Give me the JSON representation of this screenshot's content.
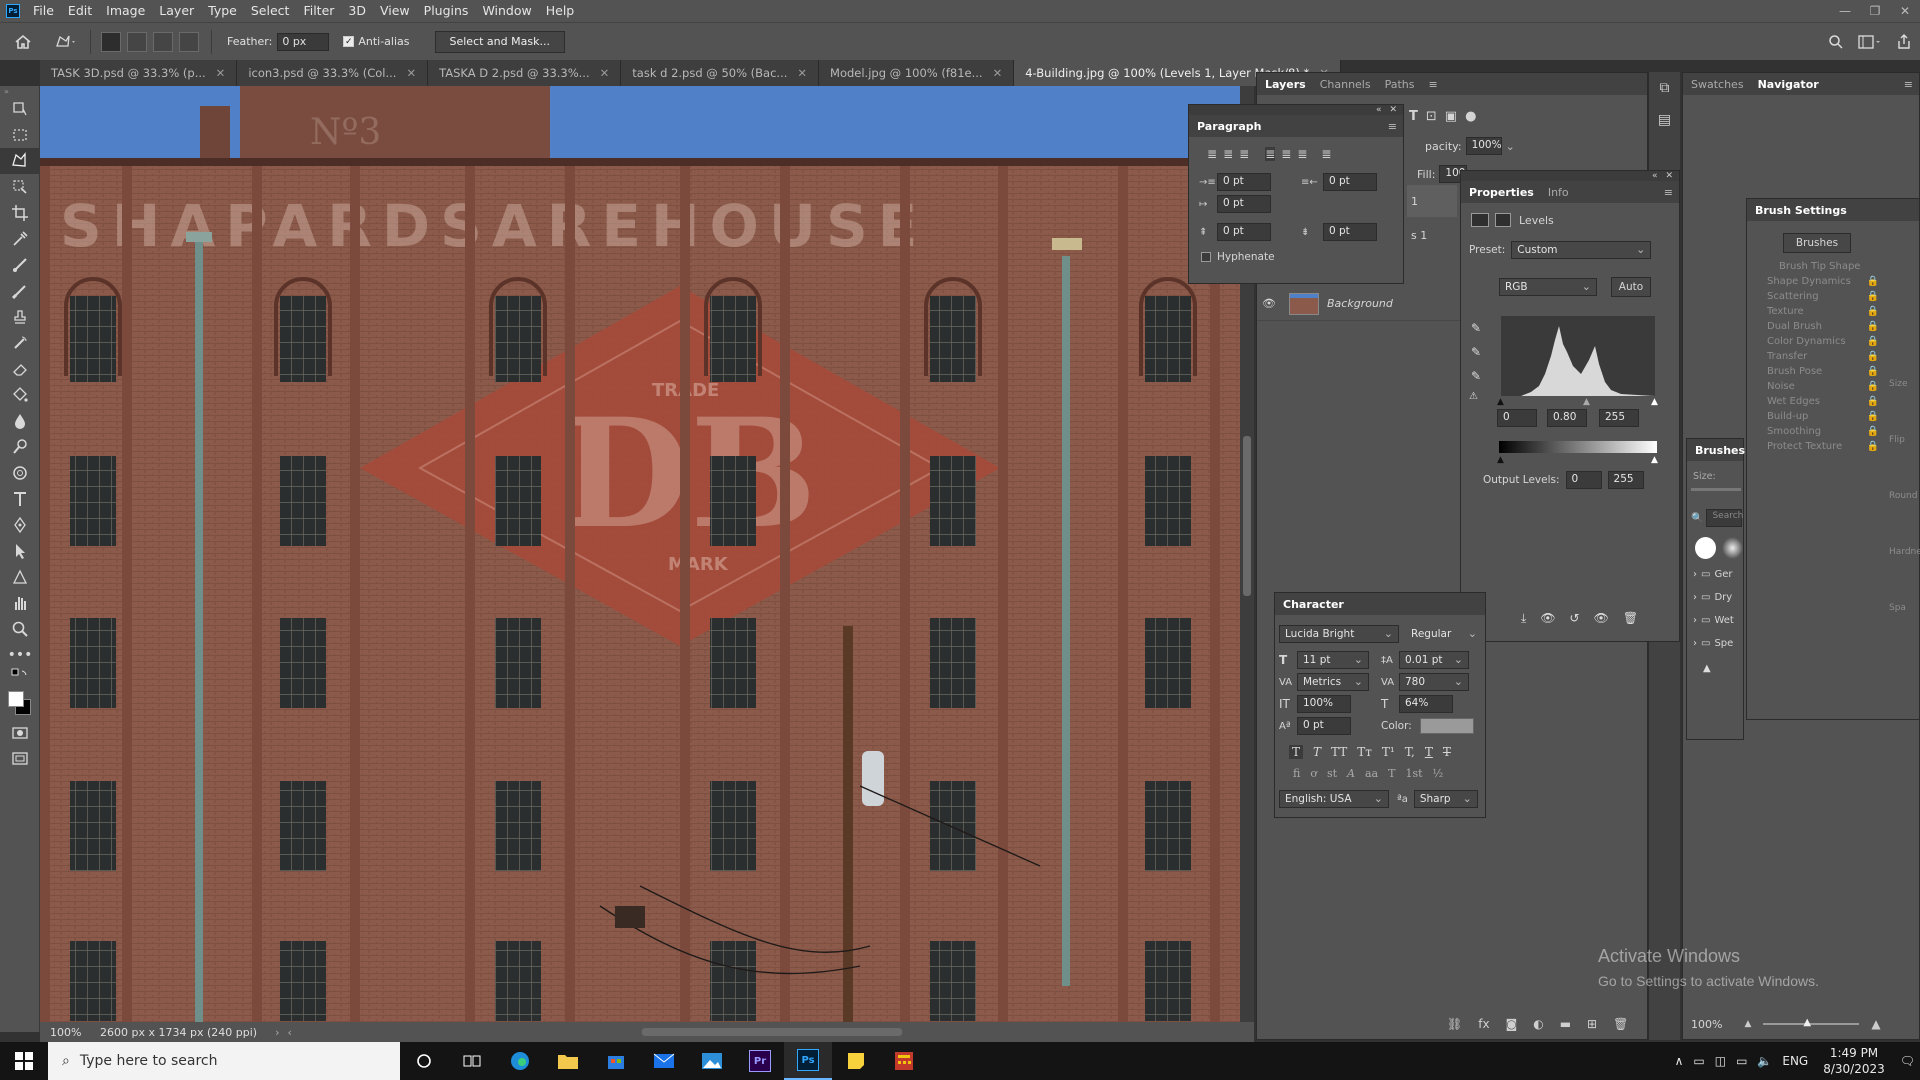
{
  "menubar": {
    "app_icon": "Ps",
    "items": [
      "File",
      "Edit",
      "Image",
      "Layer",
      "Type",
      "Select",
      "Filter",
      "3D",
      "View",
      "Plugins",
      "Window",
      "Help"
    ]
  },
  "options": {
    "feather_label": "Feather:",
    "feather_value": "0 px",
    "antialias_label": "Anti-alias",
    "antialias_checked": true,
    "select_mask_label": "Select and Mask..."
  },
  "tabs": [
    {
      "label": "TASK 3D.psd @ 33.3% (p...",
      "active": false
    },
    {
      "label": "icon3.psd @ 33.3% (Col...",
      "active": false
    },
    {
      "label": "TASKA D 2.psd @ 33.3%...",
      "active": false
    },
    {
      "label": "task d 2.psd @ 50% (Bac...",
      "active": false
    },
    {
      "label": "Model.jpg @ 100% (f81e...",
      "active": false
    },
    {
      "label": "4-Building.jpg @ 100% (Levels 1, Layer Mask/8) *",
      "active": true
    }
  ],
  "status": {
    "zoom": "100%",
    "doc_info": "2600 px x 1734 px (240 ppi)"
  },
  "canvas_image": {
    "sign_text_top": "SHAPARDSAREHOUSE",
    "sign_letters": "DB",
    "trade": "TRADE",
    "mark": "MARK"
  },
  "layers_panel": {
    "tabs": [
      "Layers",
      "Channels",
      "Paths"
    ],
    "opacity_label": "pacity:",
    "opacity_value": "100%",
    "fill_label": "Fill:",
    "fill_value": "100",
    "layer_1_partial": "1",
    "layer_2_partial": "s 1",
    "background_layer": "Background"
  },
  "paragraph_panel": {
    "title": "Paragraph",
    "indent_left": "0 pt",
    "indent_right": "0 pt",
    "first_line": "0 pt",
    "space_before": "0 pt",
    "space_after": "0 pt",
    "hyphenate_label": "Hyphenate"
  },
  "properties_panel": {
    "tabs": [
      "Properties",
      "Info"
    ],
    "adjustment": "Levels",
    "preset_label": "Preset:",
    "preset_value": "Custom",
    "channel": "RGB",
    "auto_label": "Auto",
    "input_black": "0",
    "input_gamma": "0.80",
    "input_white": "255",
    "output_label": "Output Levels:",
    "output_black": "0",
    "output_white": "255"
  },
  "character_panel": {
    "title": "Character",
    "font": "Lucida Bright",
    "style": "Regular",
    "size": "11 pt",
    "leading": "0.01 pt",
    "kerning": "Metrics",
    "tracking": "780",
    "vscale": "100%",
    "hscale": "64%",
    "baseline": "0 pt",
    "color_label": "Color:",
    "language": "English: USA",
    "antialias": "Sharp",
    "style_buttons": [
      "T",
      "T",
      "TT",
      "Tт",
      "T¹",
      "T,",
      "T",
      "T"
    ],
    "opentype_buttons": [
      "fi",
      "ơ",
      "st",
      "A",
      "aa",
      "T",
      "1st",
      "½"
    ]
  },
  "swatches_panel": {
    "tabs": [
      "Swatches",
      "Navigator"
    ],
    "zoom": "100%"
  },
  "brushes_panel": {
    "title": "Brushes",
    "size_label": "Size:",
    "search_placeholder": "Search",
    "folders": [
      "Ger",
      "Dry",
      "Wet",
      "Spe"
    ]
  },
  "brush_settings": {
    "title": "Brush Settings",
    "brushes_button": "Brushes",
    "options": [
      "Brush Tip Shape",
      "Shape Dynamics",
      "Scattering",
      "Texture",
      "Dual Brush",
      "Color Dynamics",
      "Transfer",
      "Brush Pose",
      "Noise",
      "Wet Edges",
      "Build-up",
      "Smoothing",
      "Protect Texture"
    ],
    "right_labels": [
      "Size",
      "Flip",
      "Round",
      "Hardne",
      "Spa"
    ]
  },
  "watermark": {
    "line1": "Activate Windows",
    "line2": "Go to Settings to activate Windows."
  },
  "taskbar": {
    "search_placeholder": "Type here to search",
    "lang": "ENG",
    "time": "1:49 PM",
    "date": "8/30/2023"
  }
}
